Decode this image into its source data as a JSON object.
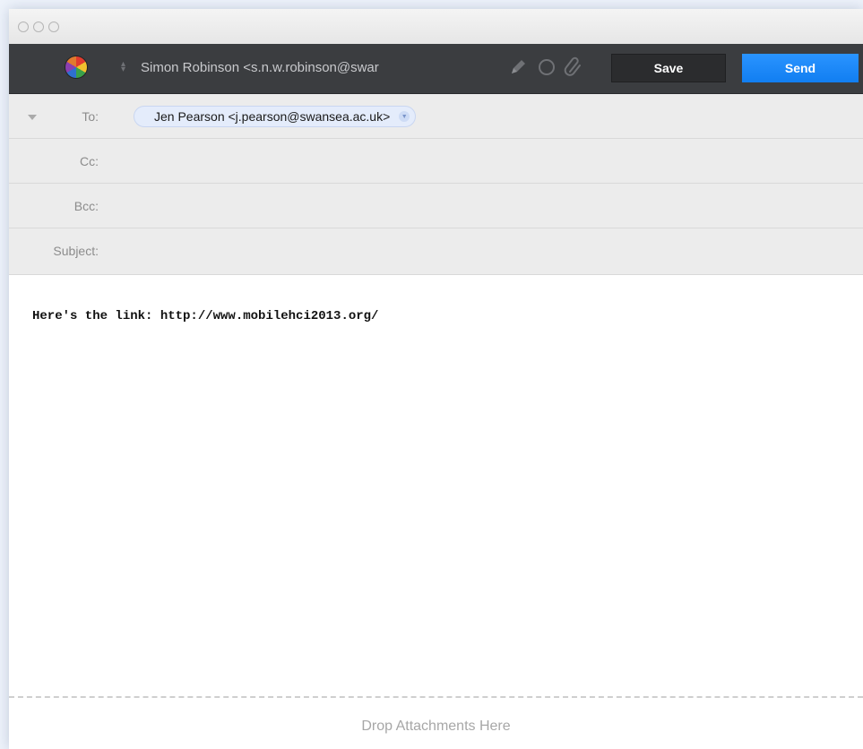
{
  "window": {
    "traffic_lights": [
      "close",
      "minimize",
      "zoom"
    ]
  },
  "toolbar": {
    "from_value": "Simon Robinson <s.n.w.robinson@swar",
    "tools": [
      "pencil-icon",
      "circle-icon",
      "paperclip-icon"
    ],
    "save_label": "Save",
    "send_label": "Send",
    "send_color": "#117ef1"
  },
  "headers": {
    "to_label": "To:",
    "to_recipient": "Jen Pearson <j.pearson@swansea.ac.uk>",
    "cc_label": "Cc:",
    "bcc_label": "Bcc:",
    "subject_label": "Subject:"
  },
  "message": {
    "body": "Here's the link: http://www.mobilehci2013.org/"
  },
  "attachments": {
    "drop_label": "Drop Attachments Here"
  }
}
